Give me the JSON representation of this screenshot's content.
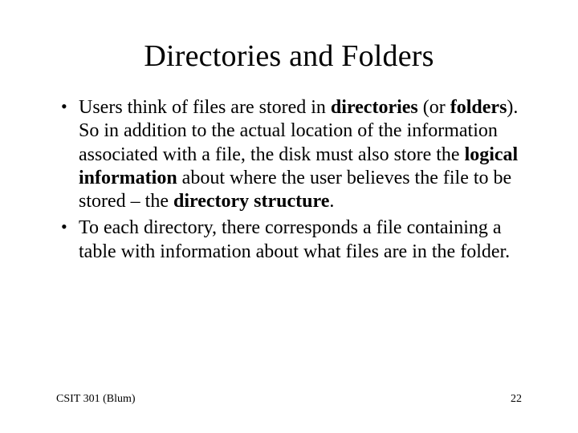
{
  "title": "Directories and Folders",
  "bullets": {
    "b1": {
      "t1": "Users think of files are stored in ",
      "t2": "directories",
      "t3": " (or ",
      "t4": "folders",
      "t5": ").  So in addition to the actual location of the information associated with a file, the disk must also store the ",
      "t6": "logical information",
      "t7": " about where the user believes the file to be stored – the ",
      "t8": "directory structure",
      "t9": "."
    },
    "b2": "To each directory, there corresponds a file containing a table with information about what files are in the folder."
  },
  "footer": {
    "left": "CSIT 301 (Blum)",
    "right": "22"
  }
}
